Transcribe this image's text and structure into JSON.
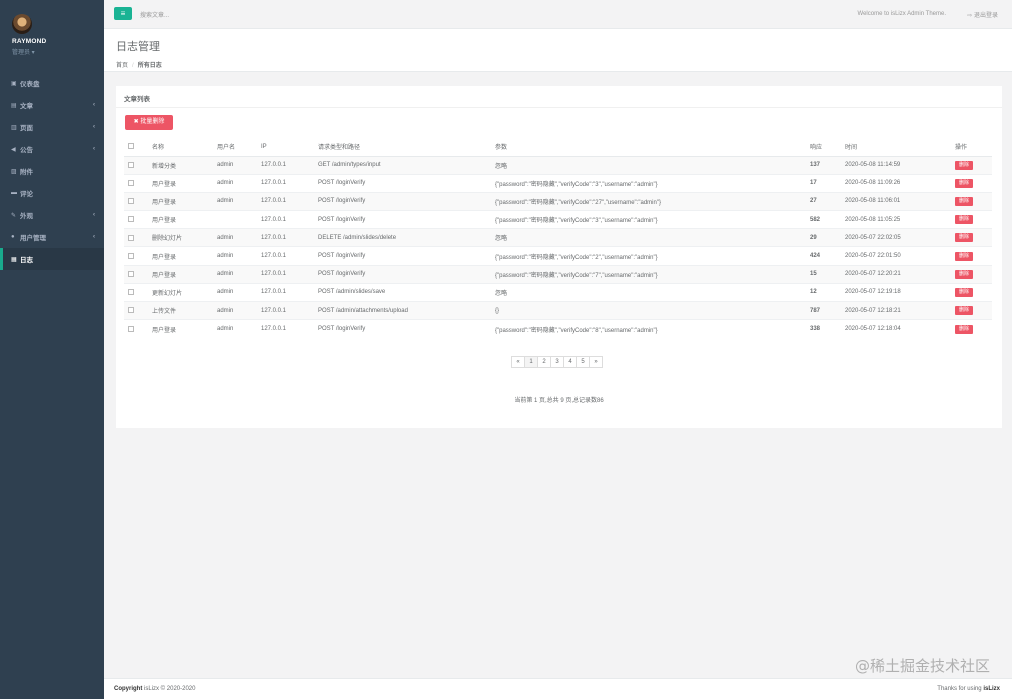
{
  "sidebar": {
    "profile": {
      "name": "RAYMOND",
      "role": "管理员 ▾"
    },
    "items": [
      {
        "label": "仪表盘",
        "icon": "dashboard-icon",
        "glyph": "▣",
        "chevron": ""
      },
      {
        "label": "文章",
        "icon": "article-icon",
        "glyph": "▤",
        "chevron": "‹"
      },
      {
        "label": "页面",
        "icon": "page-icon",
        "glyph": "▥",
        "chevron": "‹"
      },
      {
        "label": "公告",
        "icon": "announcement-icon",
        "glyph": "◀",
        "chevron": "‹"
      },
      {
        "label": "附件",
        "icon": "attachment-icon",
        "glyph": "▨",
        "chevron": ""
      },
      {
        "label": "评论",
        "icon": "comment-icon",
        "glyph": "▬",
        "chevron": ""
      },
      {
        "label": "外观",
        "icon": "brush-icon",
        "glyph": "✎",
        "chevron": "‹"
      },
      {
        "label": "用户管理",
        "icon": "user-icon",
        "glyph": "●",
        "chevron": "‹"
      },
      {
        "label": "日志",
        "icon": "log-icon",
        "glyph": "▦",
        "chevron": ""
      }
    ]
  },
  "topbar": {
    "menu_glyph": "≡",
    "search_placeholder": "搜索文章...",
    "welcome": "Welcome to isLizx Admin Theme.",
    "logout": "⇨  退出登录"
  },
  "heading": {
    "title": "日志管理",
    "crumb_home": "首页",
    "crumb_sep": "/",
    "crumb_current": "所有日志"
  },
  "panel": {
    "title": "文章列表",
    "batch_delete": "✖ 批量删除",
    "columns": [
      "",
      "名称",
      "用户名",
      "IP",
      "请求类型和路径",
      "参数",
      "响应",
      "时间",
      "操作"
    ],
    "rows": [
      {
        "name": "新增分类",
        "user": "admin",
        "ip": "127.0.0.1",
        "req": "GET /admin/types/input",
        "param": "忽略",
        "resp": "137",
        "time": "2020-05-08 11:14:59",
        "op": "删除"
      },
      {
        "name": "用户登录",
        "user": "admin",
        "ip": "127.0.0.1",
        "req": "POST /loginVerify",
        "param": "{\"password\":\"密码隐藏\",\"verifyCode\":\"3\",\"username\":\"admin\"}",
        "resp": "17",
        "time": "2020-05-08 11:09:26",
        "op": "删除"
      },
      {
        "name": "用户登录",
        "user": "admin",
        "ip": "127.0.0.1",
        "req": "POST /loginVerify",
        "param": "{\"password\":\"密码隐藏\",\"verifyCode\":\"27\",\"username\":\"admin\"}",
        "resp": "27",
        "time": "2020-05-08 11:06:01",
        "op": "删除"
      },
      {
        "name": "用户登录",
        "user": "",
        "ip": "127.0.0.1",
        "req": "POST /loginVerify",
        "param": "{\"password\":\"密码隐藏\",\"verifyCode\":\"3\",\"username\":\"admin\"}",
        "resp": "582",
        "time": "2020-05-08 11:05:25",
        "op": "删除"
      },
      {
        "name": "删除幻灯片",
        "user": "admin",
        "ip": "127.0.0.1",
        "req": "DELETE /admin/slides/delete",
        "param": "忽略",
        "resp": "29",
        "time": "2020-05-07 22:02:05",
        "op": "删除"
      },
      {
        "name": "用户登录",
        "user": "admin",
        "ip": "127.0.0.1",
        "req": "POST /loginVerify",
        "param": "{\"password\":\"密码隐藏\",\"verifyCode\":\"2\",\"username\":\"admin\"}",
        "resp": "424",
        "time": "2020-05-07 22:01:50",
        "op": "删除"
      },
      {
        "name": "用户登录",
        "user": "admin",
        "ip": "127.0.0.1",
        "req": "POST /loginVerify",
        "param": "{\"password\":\"密码隐藏\",\"verifyCode\":\"7\",\"username\":\"admin\"}",
        "resp": "15",
        "time": "2020-05-07 12:20:21",
        "op": "删除"
      },
      {
        "name": "更新幻灯片",
        "user": "admin",
        "ip": "127.0.0.1",
        "req": "POST /admin/slides/save",
        "param": "忽略",
        "resp": "12",
        "time": "2020-05-07 12:19:18",
        "op": "删除"
      },
      {
        "name": "上传文件",
        "user": "admin",
        "ip": "127.0.0.1",
        "req": "POST /admin/attachments/upload",
        "param": "{}",
        "resp": "787",
        "time": "2020-05-07 12:18:21",
        "op": "删除"
      },
      {
        "name": "用户登录",
        "user": "admin",
        "ip": "127.0.0.1",
        "req": "POST /loginVerify",
        "param": "{\"password\":\"密码隐藏\",\"verifyCode\":\"8\",\"username\":\"admin\"}",
        "resp": "338",
        "time": "2020-05-07 12:18:04",
        "op": "删除"
      }
    ],
    "pager": [
      "«",
      "1",
      "2",
      "3",
      "4",
      "5",
      "»"
    ],
    "page_info": "当前第 1 页,总共 9 页,总记录数86"
  },
  "footer": {
    "copy_prefix": "Copyright",
    "copy_rest": " isLizx © 2020-2020",
    "thanks_prefix": "Thanks for using ",
    "thanks_brand": "isLizx"
  },
  "watermark": "@稀土掘金技术社区",
  "colors": {
    "sidebar": "#2f4050",
    "accent": "#1ab394",
    "danger": "#ed5565"
  }
}
